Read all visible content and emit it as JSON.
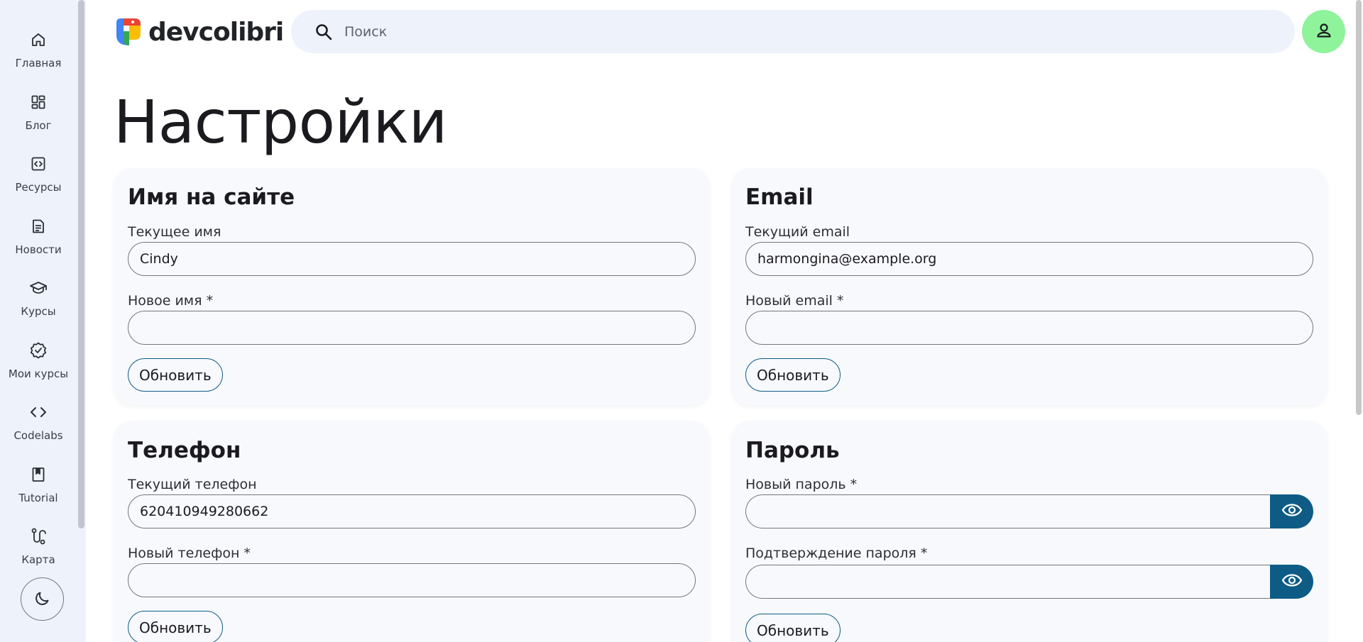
{
  "sidebar": {
    "items": [
      {
        "label": "Главная",
        "icon": "home-icon"
      },
      {
        "label": "Блог",
        "icon": "dashboard-icon"
      },
      {
        "label": "Ресурсы",
        "icon": "code-box-icon"
      },
      {
        "label": "Новости",
        "icon": "article-icon"
      },
      {
        "label": "Курсы",
        "icon": "school-icon"
      },
      {
        "label": "Мои курсы",
        "icon": "verified-icon"
      },
      {
        "label": "Codelabs",
        "icon": "code-icon"
      },
      {
        "label": "Tutorial",
        "icon": "bookmark-book-icon"
      },
      {
        "label": "Карта",
        "icon": "route-icon"
      }
    ],
    "theme_toggle_icon": "moon-icon"
  },
  "header": {
    "logo_text": "devcolibri",
    "search": {
      "placeholder": "Поиск",
      "icon": "search-icon"
    },
    "avatar_icon": "person-icon",
    "avatar_color": "#8ef39a"
  },
  "page": {
    "title": "Настройки"
  },
  "cards": {
    "name": {
      "title": "Имя на сайте",
      "current_label": "Текущее имя",
      "current_value": "Cindy",
      "new_label": "Новое имя *",
      "new_value": "",
      "button": "Обновить"
    },
    "email": {
      "title": "Email",
      "current_label": "Текущий email",
      "current_value": "harmongina@example.org",
      "new_label": "Новый email *",
      "new_value": "",
      "button": "Обновить"
    },
    "phone": {
      "title": "Телефон",
      "current_label": "Текущий телефон",
      "current_value": "620410949280662",
      "new_label": "Новый телефон *",
      "new_value": "",
      "button": "Обновить"
    },
    "password": {
      "title": "Пароль",
      "new_label": "Новый пароль *",
      "new_value": "",
      "confirm_label": "Подтверждение пароля *",
      "confirm_value": "",
      "toggle_icon": "eye-icon",
      "button": "Обновить"
    }
  },
  "colors": {
    "accent": "#0e5c86",
    "sidebar_bg": "#eef2fa",
    "card_bg": "#f8f9fd"
  }
}
